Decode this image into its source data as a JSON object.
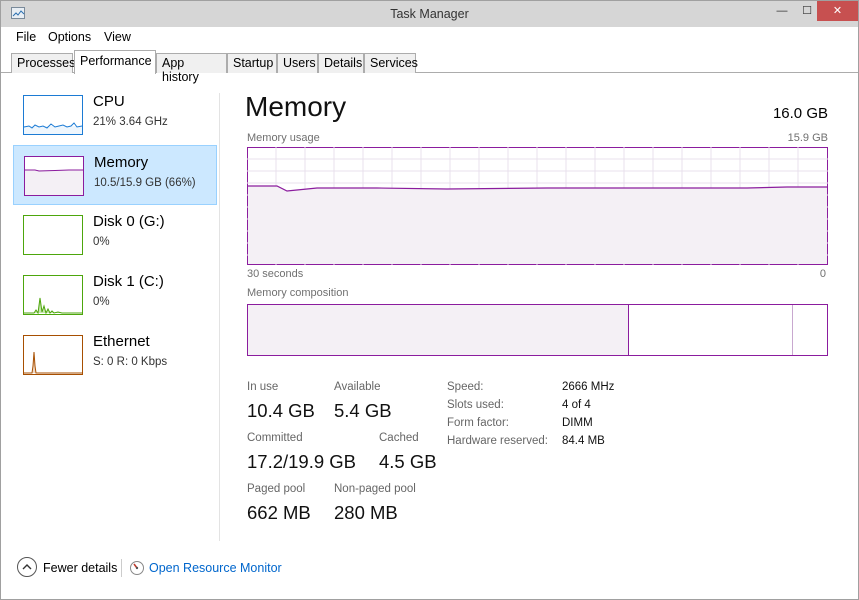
{
  "window": {
    "title": "Task Manager"
  },
  "title_buttons": {
    "minimize": "—",
    "maximize": "☐",
    "close": "✕"
  },
  "menu": [
    {
      "label": "File"
    },
    {
      "label": "Options"
    },
    {
      "label": "View"
    }
  ],
  "tabs": [
    {
      "label": "Processes"
    },
    {
      "label": "Performance"
    },
    {
      "label": "App history"
    },
    {
      "label": "Startup"
    },
    {
      "label": "Users"
    },
    {
      "label": "Details"
    },
    {
      "label": "Services"
    }
  ],
  "active_tab": "Performance",
  "sidebar": {
    "items": [
      {
        "name": "CPU",
        "detail": "21%  3.64 GHz",
        "color": "#1c7bd4",
        "selected": false
      },
      {
        "name": "Memory",
        "detail": "10.5/15.9 GB (66%)",
        "color": "#8b1c9e",
        "selected": true
      },
      {
        "name": "Disk 0 (G:)",
        "detail": "0%",
        "color": "#4da60c",
        "selected": false
      },
      {
        "name": "Disk 1 (C:)",
        "detail": "0%",
        "color": "#4da60c",
        "selected": false
      },
      {
        "name": "Ethernet",
        "detail": "S: 0  R: 0 Kbps",
        "color": "#a74f01",
        "selected": false
      }
    ]
  },
  "main": {
    "title": "Memory",
    "total": "16.0 GB",
    "usage_label": "Memory usage",
    "usage_max": "15.9 GB",
    "x_left": "30 seconds",
    "x_right": "0",
    "composition_label": "Memory composition",
    "composition": {
      "in_use_fraction": 0.658,
      "standby_fraction": 0.94
    },
    "accent": "#8b1c9e",
    "usage_fraction": 0.66,
    "stats": {
      "in_use_label": "In use",
      "in_use_value": "10.4 GB",
      "available_label": "Available",
      "available_value": "5.4 GB",
      "committed_label": "Committed",
      "committed_value": "17.2/19.9 GB",
      "cached_label": "Cached",
      "cached_value": "4.5 GB",
      "paged_label": "Paged pool",
      "paged_value": "662 MB",
      "nonpaged_label": "Non-paged pool",
      "nonpaged_value": "280 MB"
    },
    "specs": [
      {
        "key": "Speed:",
        "value": "2666 MHz"
      },
      {
        "key": "Slots used:",
        "value": "4 of 4"
      },
      {
        "key": "Form factor:",
        "value": "DIMM"
      },
      {
        "key": "Hardware reserved:",
        "value": "84.4 MB"
      }
    ]
  },
  "footer": {
    "fewer_details": "Fewer details",
    "open_monitor": "Open Resource Monitor"
  },
  "icons": {
    "app": "task-manager-icon",
    "fewer": "chevron-up-icon",
    "monitor": "resource-monitor-icon"
  }
}
